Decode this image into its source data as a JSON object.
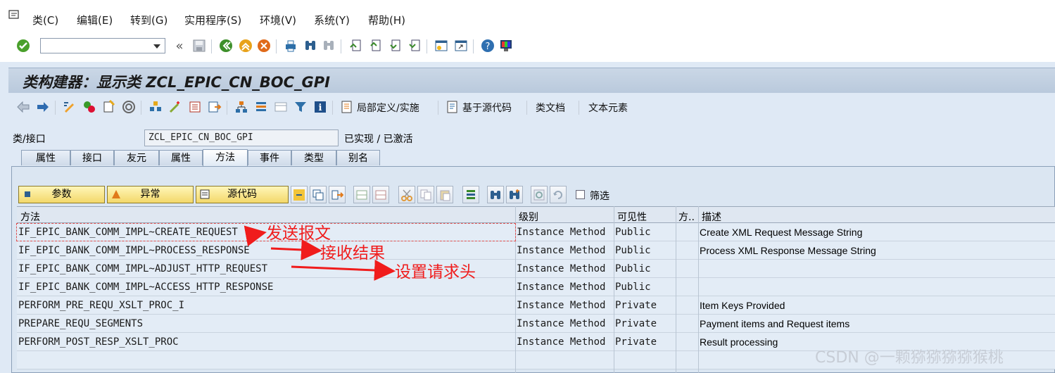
{
  "menubar": {
    "items": [
      "类(C)",
      "编辑(E)",
      "转到(G)",
      "实用程序(S)",
      "环境(V)",
      "系统(Y)",
      "帮助(H)"
    ]
  },
  "command_field": {
    "value": ""
  },
  "title": "类构建器：显示类 ZCL_EPIC_CN_BOC_GPI",
  "toolbar2": {
    "local_defs": "局部定义/实施",
    "source_based": "基于源代码",
    "class_doc": "类文档",
    "text_elements": "文本元素"
  },
  "class_field": {
    "label": "类/接口",
    "value": "ZCL_EPIC_CN_BOC_GPI",
    "status": "已实现 / 已激活"
  },
  "tabs": [
    {
      "label": "属性",
      "active": false
    },
    {
      "label": "接口",
      "active": false
    },
    {
      "label": "友元",
      "active": false
    },
    {
      "label": "属性",
      "active": false
    },
    {
      "label": "方法",
      "active": true
    },
    {
      "label": "事件",
      "active": false
    },
    {
      "label": "类型",
      "active": false
    },
    {
      "label": "别名",
      "active": false
    }
  ],
  "method_toolbar": {
    "params": "参数",
    "exceptions": "异常",
    "source": "源代码",
    "filter": "筛选"
  },
  "grid": {
    "headers": [
      "方法",
      "级别",
      "可见性",
      "方..",
      "描述"
    ],
    "rows": [
      {
        "method": "IF_EPIC_BANK_COMM_IMPL~CREATE_REQUEST",
        "level": "Instance Method",
        "visibility": "Public",
        "desc": "Create XML Request Message String"
      },
      {
        "method": "IF_EPIC_BANK_COMM_IMPL~PROCESS_RESPONSE",
        "level": "Instance Method",
        "visibility": "Public",
        "desc": "Process XML Response Message String"
      },
      {
        "method": "IF_EPIC_BANK_COMM_IMPL~ADJUST_HTTP_REQUEST",
        "level": "Instance Method",
        "visibility": "Public",
        "desc": ""
      },
      {
        "method": "IF_EPIC_BANK_COMM_IMPL~ACCESS_HTTP_RESPONSE",
        "level": "Instance Method",
        "visibility": "Public",
        "desc": ""
      },
      {
        "method": "PERFORM_PRE_REQU_XSLT_PROC_I",
        "level": "Instance Method",
        "visibility": "Private",
        "desc": "Item Keys Provided"
      },
      {
        "method": "PREPARE_REQU_SEGMENTS",
        "level": "Instance Method",
        "visibility": "Private",
        "desc": "Payment items and Request items"
      },
      {
        "method": "PERFORM_POST_RESP_XSLT_PROC",
        "level": "Instance Method",
        "visibility": "Private",
        "desc": "Result processing"
      }
    ]
  },
  "annotations": [
    "发送报文",
    "接收结果",
    "设置请求头"
  ],
  "annotation_color": "#f01c1c",
  "watermark": "CSDN @一颗猕猕猕猕猴桃"
}
